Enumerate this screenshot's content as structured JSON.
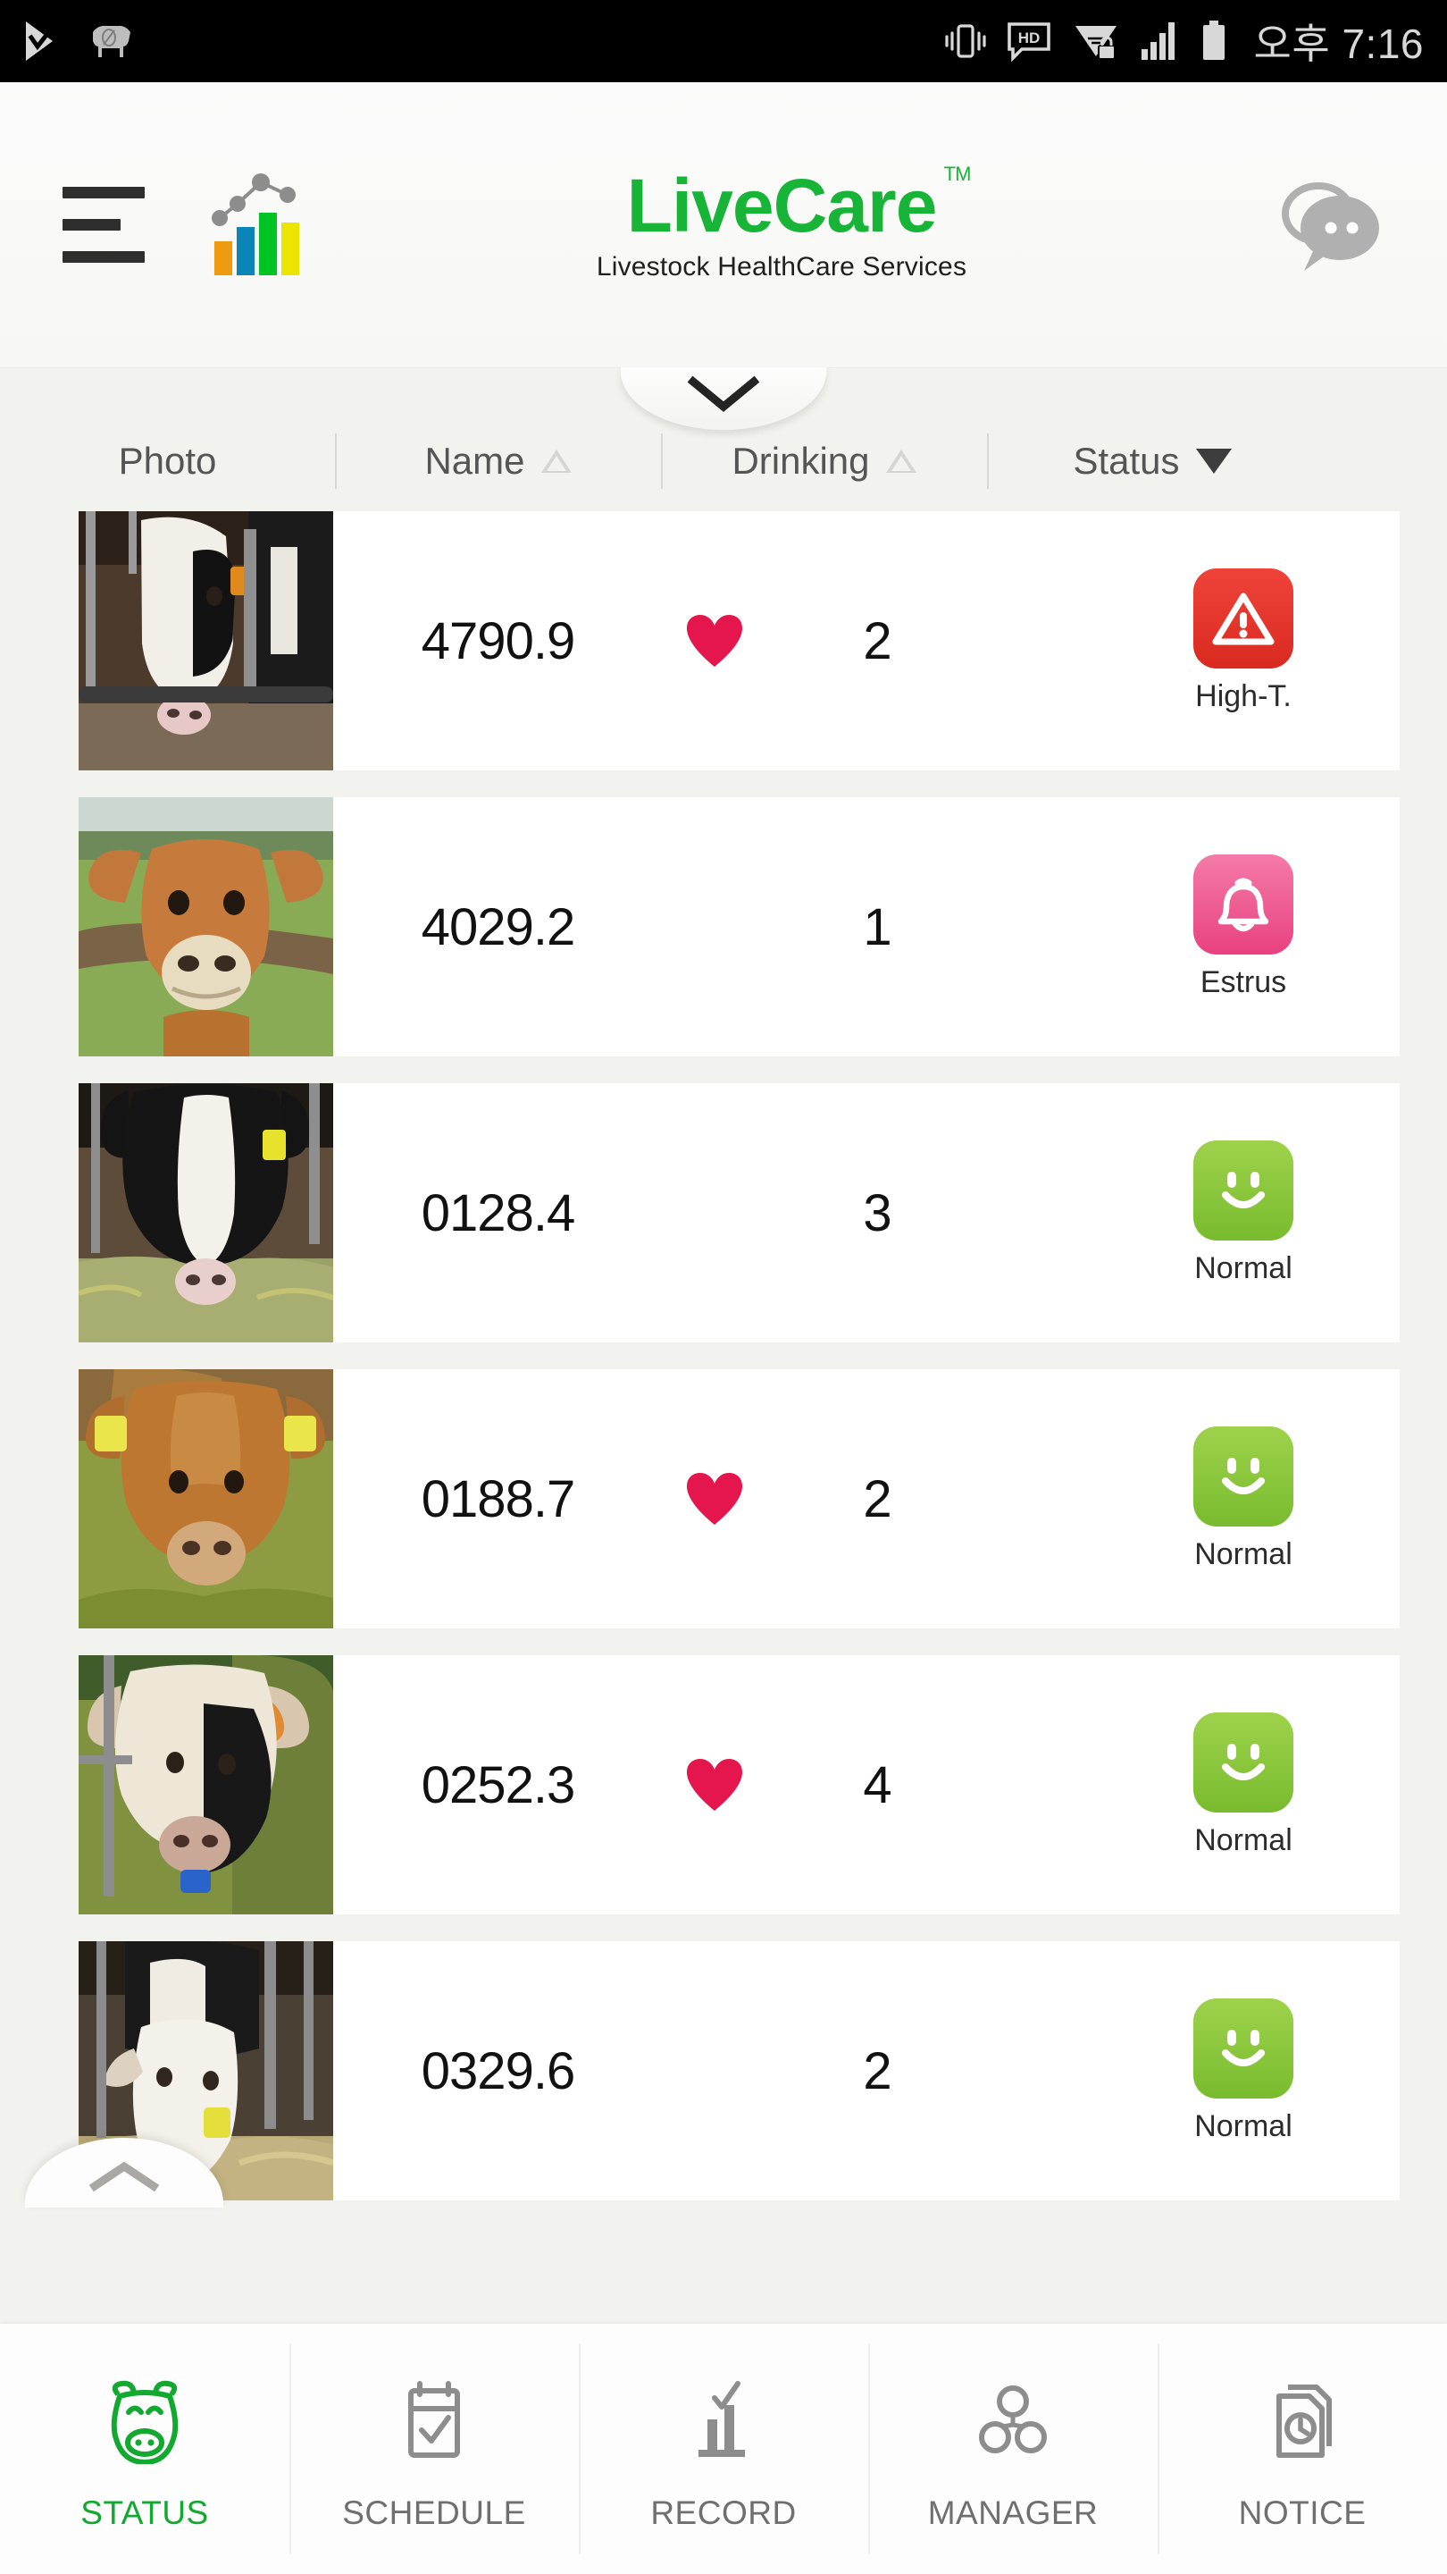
{
  "statusbar": {
    "time": "오후 7:16",
    "left_icons": [
      "play-store-icon",
      "cow-app-icon"
    ],
    "right_icons": [
      "vibrate-icon",
      "hd-icon",
      "wifi-locked-icon",
      "signal-bars-icon",
      "battery-icon"
    ]
  },
  "header": {
    "menu_icon": "hamburger-menu-icon",
    "analytics_icon": "bar-chart-icon",
    "brand_name": "LiveCare",
    "brand_tm": "TM",
    "brand_subtitle": "Livestock HealthCare Services",
    "chat_icon": "chat-bubbles-icon",
    "brand_color": "#18b438",
    "expand_icon": "chevron-down-icon"
  },
  "table": {
    "columns": [
      {
        "label": "Photo",
        "sort": "none"
      },
      {
        "label": "Name",
        "sort": "asc-inactive"
      },
      {
        "label": "Drinking",
        "sort": "asc-inactive"
      },
      {
        "label": "Status",
        "sort": "desc-active"
      }
    ],
    "rows": [
      {
        "name": "4790.9",
        "heart": true,
        "drinking": "2",
        "status": "High-T.",
        "status_type": "high-temp",
        "status_color": "#e8342a",
        "photo": "holstein-cow-in-barn"
      },
      {
        "name": "4029.2",
        "heart": false,
        "drinking": "1",
        "status": "Estrus",
        "status_type": "estrus",
        "status_color": "#ef5b91",
        "photo": "jersey-cow-in-pasture"
      },
      {
        "name": "0128.4",
        "heart": false,
        "drinking": "3",
        "status": "Normal",
        "status_type": "normal",
        "status_color": "#8cc63e",
        "photo": "holstein-cow-eating-hay"
      },
      {
        "name": "0188.7",
        "heart": true,
        "drinking": "2",
        "status": "Normal",
        "status_type": "normal",
        "status_color": "#8cc63e",
        "photo": "brown-cow-with-ear-tags"
      },
      {
        "name": "0252.3",
        "heart": true,
        "drinking": "4",
        "status": "Normal",
        "status_type": "normal",
        "status_color": "#8cc63e",
        "photo": "white-black-cow-at-gate"
      },
      {
        "name": "0329.6",
        "heart": false,
        "drinking": "2",
        "status": "Normal",
        "status_type": "normal",
        "status_color": "#8cc63e",
        "photo": "holstein-calf-in-stall"
      }
    ],
    "heart_color": "#e5164e",
    "scroll_up_icon": "chevron-up-icon"
  },
  "bottomnav": {
    "active_color": "#13a82f",
    "items": [
      {
        "label": "STATUS",
        "icon": "cow-head-icon",
        "active": true
      },
      {
        "label": "SCHEDULE",
        "icon": "calendar-check-icon",
        "active": false
      },
      {
        "label": "RECORD",
        "icon": "bar-chart-check-icon",
        "active": false
      },
      {
        "label": "MANAGER",
        "icon": "people-group-icon",
        "active": false
      },
      {
        "label": "NOTICE",
        "icon": "document-clock-icon",
        "active": false
      }
    ]
  }
}
